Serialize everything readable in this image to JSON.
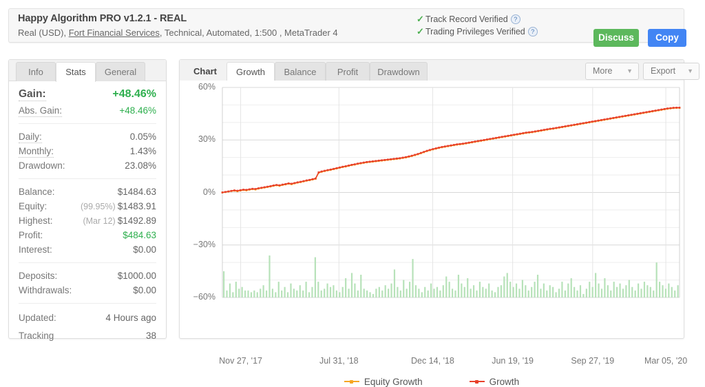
{
  "header": {
    "title": "Happy Algorithm PRO v1.2.1 - REAL",
    "subtitle_prefix": "Real (USD), ",
    "broker_link": "Fort Financial Services",
    "subtitle_suffix": ", Technical, Automated, 1:500 , MetaTrader 4",
    "verifications": [
      {
        "label": "Track Record Verified",
        "icon": "check-icon",
        "help": "?"
      },
      {
        "label": "Trading Privileges Verified",
        "icon": "check-icon",
        "help": "?"
      }
    ],
    "discuss_label": "Discuss",
    "copy_label": "Copy",
    "colors": {
      "discuss": "#5cb85c",
      "copy": "#4285f4",
      "check": "#4caf50"
    }
  },
  "stats_panel": {
    "tabs": [
      {
        "label": "Info",
        "active": false
      },
      {
        "label": "Stats",
        "active": true
      },
      {
        "label": "General",
        "active": false
      }
    ],
    "rows": [
      {
        "label": "Gain:",
        "value": "+48.46%",
        "color": "green",
        "big": true,
        "dotted": true
      },
      {
        "label": "Abs. Gain:",
        "value": "+48.46%",
        "color": "green",
        "dotted": true
      },
      {
        "label": "Daily:",
        "value": "0.05%",
        "dotted": true
      },
      {
        "label": "Monthly:",
        "value": "1.43%",
        "dotted": true
      },
      {
        "label": "Drawdown:",
        "value": "23.08%",
        "dotted": false
      },
      {
        "label": "Balance:",
        "value": "$1484.63"
      },
      {
        "label": "Equity:",
        "prefix": "(99.95%)",
        "value": "$1483.91"
      },
      {
        "label": "Highest:",
        "prefix": "(Mar 12)",
        "value": "$1492.89"
      },
      {
        "label": "Profit:",
        "value": "$484.63",
        "color": "green"
      },
      {
        "label": "Interest:",
        "value": "$0.00"
      },
      {
        "label": "Deposits:",
        "value": "$1000.00"
      },
      {
        "label": "Withdrawals:",
        "value": "$0.00"
      },
      {
        "label": "Updated:",
        "value": "4 Hours ago"
      },
      {
        "label": "Tracking",
        "value": "38"
      }
    ]
  },
  "chart_panel": {
    "section_label": "Chart",
    "tabs": [
      {
        "label": "Growth",
        "active": true
      },
      {
        "label": "Balance",
        "active": false
      },
      {
        "label": "Profit",
        "active": false
      },
      {
        "label": "Drawdown",
        "active": false
      }
    ],
    "more_label": "More",
    "export_label": "Export",
    "arrow": "▼"
  },
  "chart_data": {
    "type": "line",
    "title": "",
    "xlabel": "",
    "ylabel": "",
    "ylim": [
      -60,
      60
    ],
    "yticks": [
      60,
      30,
      0,
      -30,
      -60
    ],
    "ytick_labels": [
      "60%",
      "30%",
      "0%",
      "−30%",
      "−60%"
    ],
    "grid": true,
    "minor_grid_step": 10,
    "legend_position": "bottom",
    "xtick_labels": [
      "Nov 27, '17",
      "Jul 31, '18",
      "Dec 14, '18",
      "Jun 19, '19",
      "Sep 27, '19",
      "Mar 05, '20"
    ],
    "xtick_positions_pct": [
      4,
      25.5,
      46,
      63.5,
      81,
      97
    ],
    "series": [
      {
        "name": "Growth",
        "color": "#e8402a",
        "marker": "dot",
        "values": [
          0.0,
          0.3,
          0.6,
          0.9,
          1.2,
          1.0,
          1.3,
          1.6,
          1.5,
          1.8,
          2.1,
          2.0,
          2.4,
          2.7,
          3.0,
          3.3,
          3.6,
          4.0,
          4.3,
          4.1,
          4.5,
          4.8,
          5.2,
          5.0,
          5.4,
          5.8,
          6.1,
          6.5,
          6.9,
          7.2,
          7.6,
          8.0,
          11.5,
          12.0,
          12.4,
          12.8,
          13.1,
          13.5,
          13.9,
          14.3,
          14.7,
          15.0,
          15.4,
          15.8,
          16.1,
          16.5,
          16.8,
          17.1,
          17.4,
          17.6,
          17.8,
          18.0,
          18.2,
          18.4,
          18.6,
          18.8,
          19.0,
          19.2,
          19.4,
          19.6,
          19.9,
          20.2,
          20.6,
          21.0,
          21.5,
          22.0,
          22.6,
          23.2,
          23.8,
          24.3,
          24.8,
          25.2,
          25.6,
          26.0,
          26.3,
          26.6,
          26.9,
          27.2,
          27.5,
          27.7,
          27.9,
          28.2,
          28.5,
          28.8,
          29.1,
          29.4,
          29.7,
          30.0,
          30.3,
          30.6,
          30.9,
          31.2,
          31.5,
          31.8,
          32.1,
          32.4,
          32.7,
          33.0,
          33.3,
          33.6,
          33.9,
          34.2,
          34.4,
          34.6,
          34.9,
          35.2,
          35.5,
          35.8,
          36.1,
          36.4,
          36.6,
          36.9,
          37.2,
          37.5,
          37.8,
          38.1,
          38.4,
          38.7,
          39.0,
          39.3,
          39.6,
          39.9,
          40.2,
          40.5,
          40.8,
          41.1,
          41.4,
          41.7,
          42.0,
          42.3,
          42.6,
          42.9,
          43.2,
          43.5,
          43.8,
          44.1,
          44.4,
          44.7,
          45.0,
          45.3,
          45.6,
          45.9,
          46.2,
          46.5,
          46.8,
          47.1,
          47.4,
          47.7,
          48.0,
          48.2,
          48.4,
          48.46,
          48.46
        ]
      },
      {
        "name": "Equity Growth",
        "color": "#f6a623",
        "marker": "dot",
        "values": [
          0.0,
          0.2,
          0.5,
          0.8,
          1.0,
          0.7,
          1.1,
          1.4,
          1.2,
          1.6,
          1.9,
          1.7,
          2.2,
          2.5,
          2.8,
          3.1,
          3.4,
          3.8,
          4.1,
          3.8,
          4.3,
          4.6,
          5.0,
          4.7,
          5.2,
          5.6,
          5.9,
          6.3,
          6.7,
          7.0,
          7.4,
          7.8,
          11.2,
          11.8,
          12.2,
          12.6,
          12.9,
          13.3,
          13.7,
          14.1,
          14.5,
          14.8,
          15.2,
          15.6,
          15.9,
          16.3,
          16.6,
          16.9,
          17.2,
          17.4,
          17.6,
          17.8,
          18.0,
          18.2,
          18.4,
          18.6,
          18.8,
          19.0,
          19.2,
          19.4,
          19.7,
          20.0,
          20.4,
          20.8,
          21.3,
          21.8,
          22.4,
          23.0,
          23.6,
          24.1,
          24.6,
          25.0,
          25.4,
          25.8,
          26.1,
          26.4,
          26.7,
          27.0,
          27.3,
          27.5,
          27.7,
          28.0,
          28.3,
          28.6,
          28.9,
          29.2,
          29.5,
          29.8,
          30.1,
          30.4,
          30.7,
          31.0,
          31.3,
          31.6,
          31.9,
          32.2,
          32.5,
          32.8,
          33.1,
          33.4,
          33.7,
          34.0,
          34.2,
          34.4,
          34.7,
          35.0,
          35.3,
          35.6,
          35.9,
          36.2,
          36.4,
          36.7,
          37.0,
          37.3,
          37.6,
          37.9,
          38.2,
          38.5,
          38.8,
          39.1,
          39.4,
          39.7,
          40.0,
          40.3,
          40.6,
          40.9,
          41.2,
          41.5,
          41.8,
          42.1,
          42.4,
          42.7,
          43.0,
          43.3,
          43.6,
          43.9,
          44.2,
          44.5,
          44.8,
          45.1,
          45.4,
          45.7,
          46.0,
          46.3,
          46.6,
          46.9,
          47.2,
          47.5,
          47.8,
          48.0,
          48.2,
          48.3,
          48.3
        ]
      }
    ],
    "bars": {
      "name": "Drawdown bars",
      "color": "#b7e2b9",
      "baseline": -60,
      "values": [
        15,
        4,
        8,
        3,
        9,
        5,
        6,
        4,
        4,
        3,
        4,
        3,
        5,
        7,
        4,
        24,
        5,
        3,
        9,
        4,
        6,
        3,
        8,
        5,
        4,
        7,
        4,
        9,
        3,
        6,
        23,
        9,
        4,
        5,
        8,
        6,
        7,
        4,
        3,
        6,
        11,
        5,
        14,
        8,
        4,
        13,
        5,
        4,
        3,
        2,
        5,
        6,
        4,
        7,
        5,
        8,
        16,
        6,
        4,
        10,
        5,
        9,
        22,
        7,
        5,
        3,
        6,
        4,
        8,
        5,
        6,
        4,
        7,
        12,
        9,
        5,
        4,
        13,
        8,
        6,
        11,
        5,
        7,
        4,
        9,
        6,
        5,
        8,
        4,
        3,
        6,
        7,
        12,
        14,
        9,
        6,
        8,
        5,
        10,
        7,
        4,
        6,
        9,
        13,
        5,
        8,
        4,
        7,
        6,
        3,
        5,
        9,
        4,
        8,
        11,
        6,
        4,
        7,
        2,
        5,
        9,
        6,
        14,
        8,
        5,
        11,
        7,
        4,
        9,
        6,
        8,
        5,
        7,
        10,
        6,
        4,
        8,
        5,
        9,
        7,
        6,
        4,
        20,
        9,
        7,
        5,
        8,
        6,
        4,
        7
      ]
    },
    "legend": [
      {
        "name": "Equity Growth",
        "color": "#f6a623"
      },
      {
        "name": "Growth",
        "color": "#e8402a"
      }
    ]
  }
}
